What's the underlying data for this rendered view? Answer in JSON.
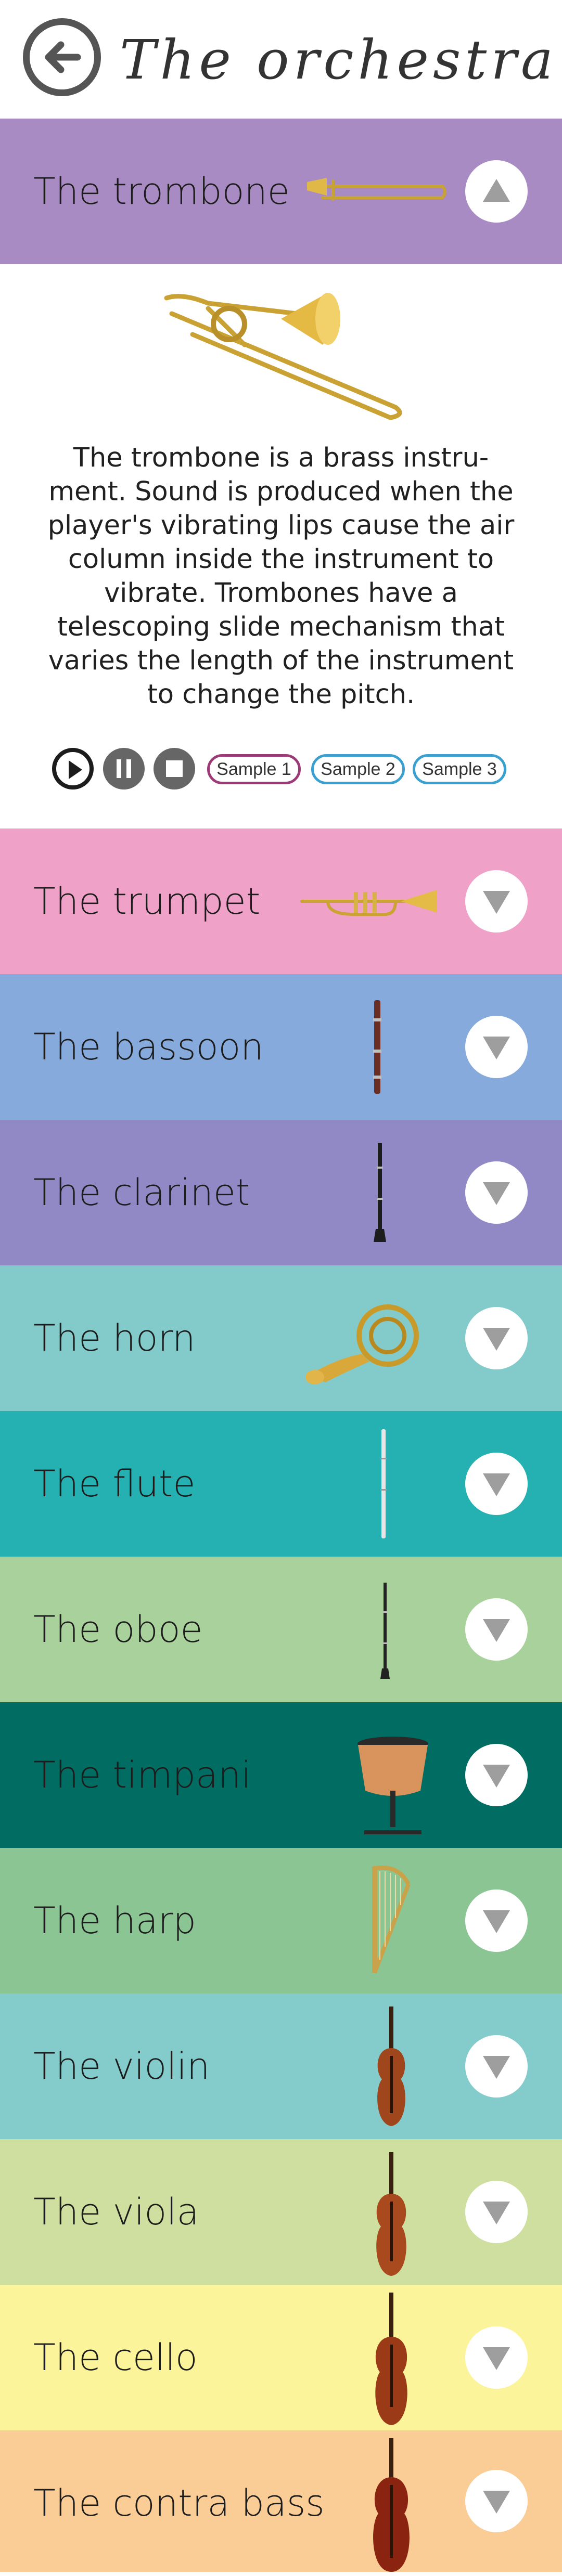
{
  "header": {
    "title": "The orchestra"
  },
  "colors": {
    "trombone": "#a88bc2",
    "trumpet": "#f0a1c8",
    "bassoon": "#86aadc",
    "clarinet": "#9188c6",
    "horn": "#83cbcb",
    "flute": "#25b1b1",
    "oboe": "#a9d19b",
    "timpani": "#006c62",
    "harp": "#8bc594",
    "violin": "#84cbcb",
    "viola": "#cfdf9f",
    "cello": "#fbf49a",
    "contrabass": "#fbcd96",
    "sample1_border": "#9c3a78",
    "sample_border": "#3aa1cf",
    "toggle_arrow": "#9e9e9e"
  },
  "expanded": {
    "name": "The trombone",
    "description": "The trombone is a brass instru- ment. Sound is produced when the player's vibrating lips cause the air column inside the instrument to vibrate. Trombones have a telescoping slide mechanism that varies the length of the instrument to change the pitch.",
    "controls": [
      "play-icon",
      "pause-icon",
      "stop-icon"
    ],
    "samples": [
      "Sample 1",
      "Sample 2",
      "Sample 3"
    ]
  },
  "instruments": [
    {
      "name": "The trumpet"
    },
    {
      "name": "The bassoon"
    },
    {
      "name": "The clarinet"
    },
    {
      "name": "The horn"
    },
    {
      "name": "The flute"
    },
    {
      "name": "The oboe"
    },
    {
      "name": "The timpani"
    },
    {
      "name": "The harp"
    },
    {
      "name": "The violin"
    },
    {
      "name": "The viola"
    },
    {
      "name": "The cello"
    },
    {
      "name": "The contra bass"
    }
  ]
}
